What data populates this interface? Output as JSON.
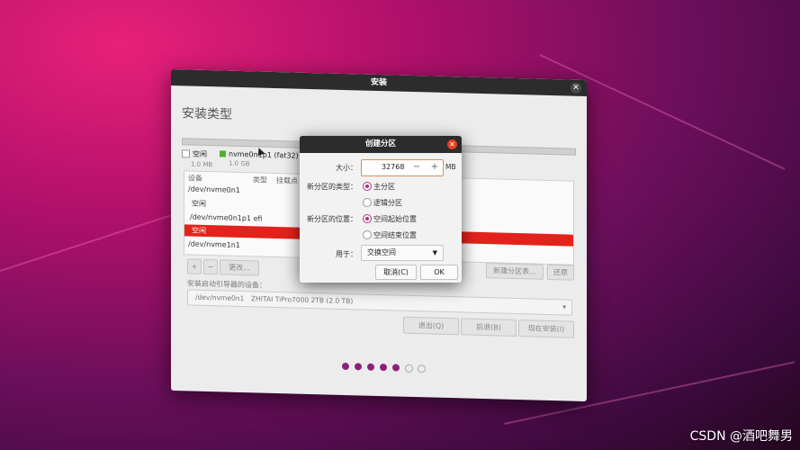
{
  "window": {
    "title": "安装",
    "close_icon": "close-icon"
  },
  "heading": "安装类型",
  "disk_legend": [
    {
      "label": "空闲",
      "size": "1.0 MB",
      "color": "#ffffff"
    },
    {
      "label": "nvme0n1p1 (fat32)",
      "size": "1.0 GB",
      "color": "#4caf2e"
    }
  ],
  "table": {
    "columns": [
      "设备",
      "类型",
      "挂载点"
    ],
    "rows": [
      {
        "text": "/dev/nvme0n1",
        "selected": false
      },
      {
        "text": "空闲",
        "selected": false
      },
      {
        "text": "/dev/nvme0n1p1  efi",
        "selected": false
      },
      {
        "text": "空闲",
        "selected": true
      },
      {
        "text": "/dev/nvme1n1",
        "selected": false
      }
    ]
  },
  "table_buttons": {
    "add": "+",
    "remove": "−",
    "change": "更改...",
    "new_table": "新建分区表...",
    "revert": "还原"
  },
  "boot": {
    "label": "安装启动引导器的设备：",
    "device": "/dev/nvme0n1",
    "model": "ZHITAI TiPro7000 2TB (2.0 TB)"
  },
  "nav": {
    "quit": "退出(Q)",
    "back": "后退(B)",
    "install": "现在安装(I)"
  },
  "progress": {
    "total": 7,
    "completed": 5
  },
  "dialog": {
    "title": "创建分区",
    "size_label": "大小：",
    "size_value": "32768",
    "unit": "MB",
    "minus": "−",
    "plus": "+",
    "type_label": "新分区的类型：",
    "type_options": [
      "主分区",
      "逻辑分区"
    ],
    "type_selected": 0,
    "position_label": "新分区的位置：",
    "position_options": [
      "空间起始位置",
      "空间结束位置"
    ],
    "position_selected": 0,
    "use_label": "用于：",
    "use_value": "交换空间",
    "cancel": "取消(C)",
    "ok": "OK"
  },
  "watermark": "CSDN @酒吧舞男"
}
